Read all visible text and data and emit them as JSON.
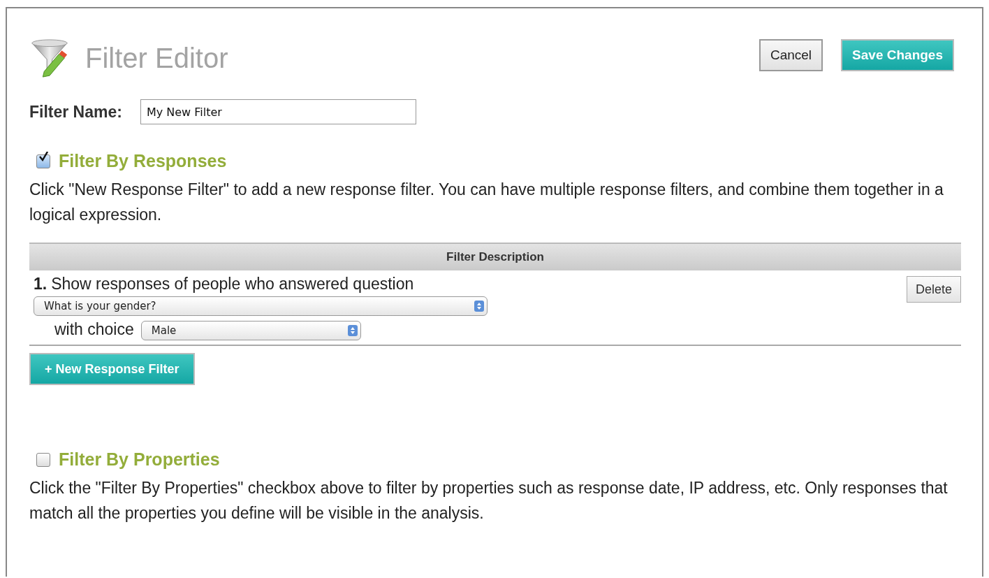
{
  "header": {
    "title": "Filter Editor",
    "buttons": [
      {
        "label": "Cancel",
        "kind": "secondary"
      },
      {
        "label": "Save Changes",
        "kind": "primary"
      }
    ]
  },
  "filter_name": {
    "label": "Filter Name:",
    "value": "My New Filter"
  },
  "responses_section": {
    "checked": true,
    "heading": "Filter By Responses",
    "description": "Click \"New Response Filter\" to add a new response filter. You can have multiple response filters, and combine them together in a logical expression.",
    "table": {
      "column": "Filter Description",
      "rows": [
        {
          "number": "1.",
          "text": "Show responses of people who answered question",
          "question": "What is your gender?",
          "choice_label": "with choice",
          "choice": "Male",
          "delete": "Delete"
        }
      ]
    },
    "add_button": "+ New Response Filter"
  },
  "properties_section": {
    "checked": false,
    "heading": "Filter By Properties",
    "description": "Click the \"Filter By Properties\" checkbox above to filter by properties such as response date, IP address, etc. Only responses that match all the properties you define will be visible in the analysis."
  }
}
